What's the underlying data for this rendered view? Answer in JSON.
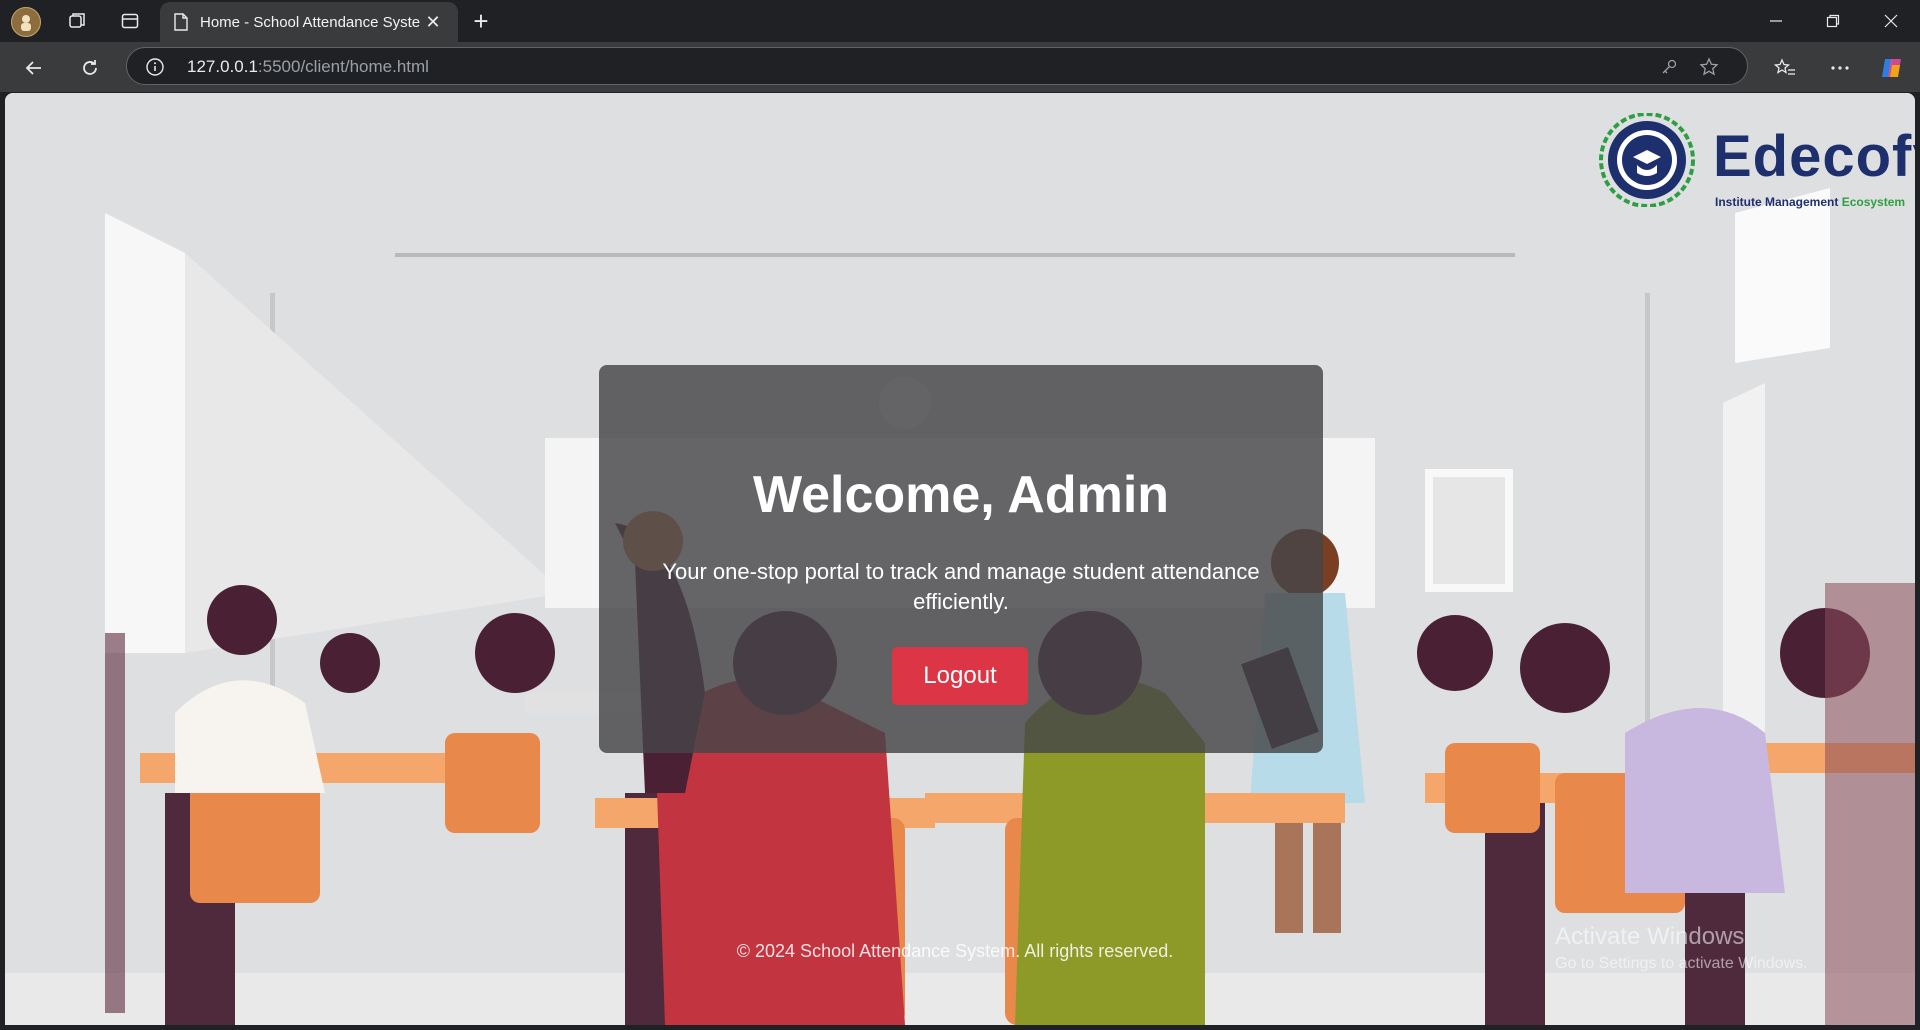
{
  "browser": {
    "tab_title": "Home - School Attendance Syste",
    "url_host": "127.0.0.1",
    "url_rest": ":5500/client/home.html"
  },
  "page": {
    "logo_brand": "Edecofy",
    "logo_tagline": "Institute Management",
    "logo_tagline_accent": "Ecosystem",
    "welcome": "Welcome, Admin",
    "subtitle": "Your one-stop portal to track and manage student attendance efficiently.",
    "logout_label": "Logout",
    "footer": "© 2024 School Attendance System. All rights reserved."
  },
  "os_overlay": {
    "activate_title": "Activate Windows",
    "activate_sub": "Go to Settings to activate Windows."
  },
  "colors": {
    "logout_button": "#dc3545",
    "brand_navy": "#1e2f6d",
    "brand_green": "#2e9e44"
  }
}
